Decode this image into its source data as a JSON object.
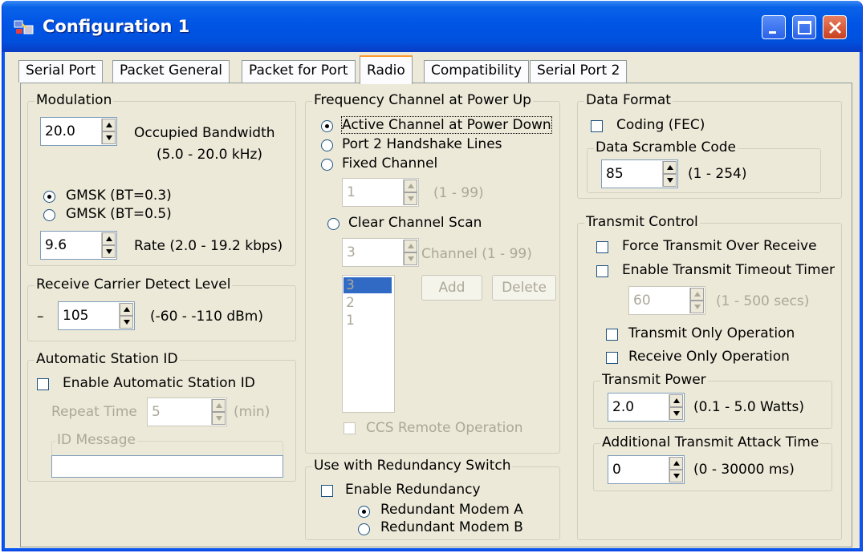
{
  "window": {
    "title": "Configuration 1",
    "accent_color": "#0055e5",
    "buttons": [
      "minimize-icon",
      "maximize-icon",
      "close-icon"
    ]
  },
  "tabs": [
    {
      "label": "Serial Port",
      "active": false
    },
    {
      "label": "Packet General",
      "active": false
    },
    {
      "label": "Packet for Port",
      "active": false
    },
    {
      "label": "Radio",
      "active": true
    },
    {
      "label": "Compatibility",
      "active": false
    },
    {
      "label": "Serial Port 2",
      "active": false
    }
  ],
  "modulation": {
    "title": "Modulation",
    "bandwidth_value": "20.0",
    "bandwidth_label": "Occupied Bandwidth",
    "bandwidth_range": "(5.0 - 20.0 kHz)",
    "gmsk_03": "GMSK (BT=0.3)",
    "gmsk_05": "GMSK (BT=0.5)",
    "rate_value": "9.6",
    "rate_label": "Rate (2.0 - 19.2 kbps)"
  },
  "carrier": {
    "title": "Receive Carrier Detect Level",
    "prefix": "–",
    "value": "105",
    "range": "(-60 - -110 dBm)"
  },
  "station_id": {
    "title": "Automatic Station ID",
    "enable_label": "Enable Automatic Station ID",
    "repeat_label": "Repeat Time",
    "repeat_value": "5",
    "repeat_unit": "(min)",
    "message_title": "ID Message",
    "message_value": ""
  },
  "frequency": {
    "title": "Frequency Channel at Power Up",
    "opt_active": "Active Channel at Power Down",
    "opt_handshake": "Port 2 Handshake Lines",
    "opt_fixed": "Fixed Channel",
    "fixed_value": "1",
    "fixed_range": "(1 - 99)",
    "opt_scan": "Clear Channel Scan",
    "scan_value": "3",
    "scan_label": "Channel (1 - 99)",
    "add_label": "Add",
    "delete_label": "Delete",
    "channels": [
      "3",
      "2",
      "1"
    ],
    "ccs_label": "CCS Remote Operation"
  },
  "redundancy": {
    "title": "Use with Redundancy Switch",
    "enable_label": "Enable Redundancy",
    "modem_a": "Redundant Modem A",
    "modem_b": "Redundant Modem B"
  },
  "data_format": {
    "title": "Data Format",
    "coding_label": "Coding (FEC)",
    "scramble_title": "Data Scramble Code",
    "scramble_value": "85",
    "scramble_range": "(1 - 254)"
  },
  "transmit": {
    "title": "Transmit Control",
    "force_label": "Force Transmit Over Receive",
    "timeout_label": "Enable Transmit Timeout Timer",
    "timeout_value": "60",
    "timeout_range": "(1 - 500 secs)",
    "tx_only_label": "Transmit Only Operation",
    "rx_only_label": "Receive Only Operation",
    "power_title": "Transmit Power",
    "power_value": "2.0",
    "power_range": "(0.1 - 5.0 Watts)",
    "attack_title": "Additional Transmit Attack Time",
    "attack_value": "0",
    "attack_range": "(0 - 30000 ms)"
  }
}
